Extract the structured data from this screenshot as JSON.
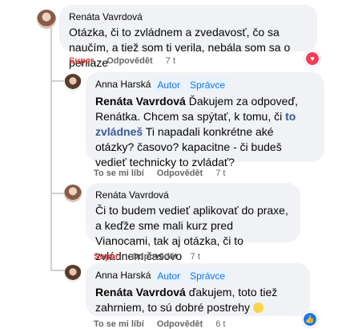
{
  "colors": {
    "accent": "#1b74e4",
    "super": "#e53c3c",
    "heart": "#f33e58",
    "like": "#1877f2"
  },
  "comments": [
    {
      "author": "Renáta Vavrdová",
      "text": "Otázka, či to zvládnem a zvedavosť, čo sa naučím, a tiež som ti verila, nebála som sa o peniaze",
      "reaction_label": "Super",
      "reply_label": "Odpovědět",
      "time": "7 t",
      "reaction_icon": "heart-icon"
    },
    {
      "author": "Anna Harská",
      "badges": [
        "Autor",
        "Správce"
      ],
      "mention": "Renáta Vavrdová",
      "text_1": "Ďakujem za odpoveď, Renátka. Chcem sa spýtať, k tomu, či",
      "link": "to zvládneš",
      "text_2": "Ti napadali konkrétne aké otázky? časovo? kapacitne - či budeš vedieť technicky to zvládať?",
      "reaction_label": "To se mi líbí",
      "reply_label": "Odpovědět",
      "time": "7 t"
    },
    {
      "author": "Renáta Vavrdová",
      "text": "Či to budem vedieť aplikovať do praxe, a keďže sme mali kurz pred Vianocami, tak aj otázka, či to zvládnem časovo",
      "reaction_label": "Super",
      "reply_label": "Odpovědět",
      "time": "7 t"
    },
    {
      "author": "Anna Harská",
      "badges": [
        "Autor",
        "Správce"
      ],
      "mention": "Renáta Vavrdová",
      "text": "ďakujem, toto tiež zahrniem, to sú dobré postrehy",
      "reaction_label": "To se mi líbí",
      "reply_label": "Odpovědět",
      "time": "6 t",
      "reaction_icon": "like-icon"
    }
  ]
}
